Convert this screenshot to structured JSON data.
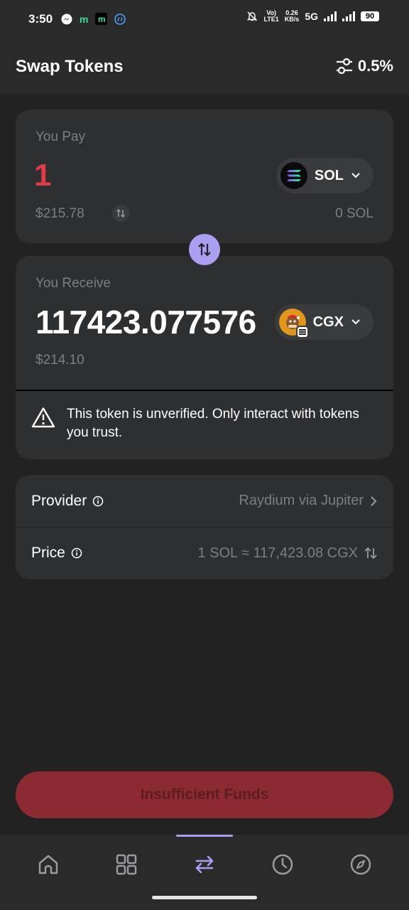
{
  "status_bar": {
    "time": "3:50",
    "net_type": "Vo)) LTE1",
    "net_speed": "0.26 KB/s",
    "signal": "5G",
    "battery": "90"
  },
  "header": {
    "title": "Swap Tokens",
    "slippage": "0.5%"
  },
  "pay": {
    "label": "You Pay",
    "amount": "1",
    "usd_value": "$215.78",
    "balance": "0 SOL",
    "token": {
      "symbol": "SOL",
      "icon": "solana-logo"
    }
  },
  "receive": {
    "label": "You Receive",
    "amount": "117423.077576",
    "usd_value": "$214.10",
    "token": {
      "symbol": "CGX",
      "icon": "cgx-token-logo"
    },
    "warning": "This token is unverified. Only interact with tokens you trust."
  },
  "info": {
    "provider_label": "Provider",
    "provider_value": "Raydium via Jupiter",
    "price_label": "Price",
    "price_value": "1 SOL ≈ 117,423.08 CGX"
  },
  "cta": {
    "label": "Insufficient Funds"
  },
  "nav": {
    "items": [
      "home-icon",
      "grid-icon",
      "swap-icon",
      "history-icon",
      "explore-icon"
    ],
    "active": "swap-icon"
  },
  "colors": {
    "accent": "#ab9ff2",
    "error": "#e23b48",
    "cta_bg": "#8c2a32"
  }
}
